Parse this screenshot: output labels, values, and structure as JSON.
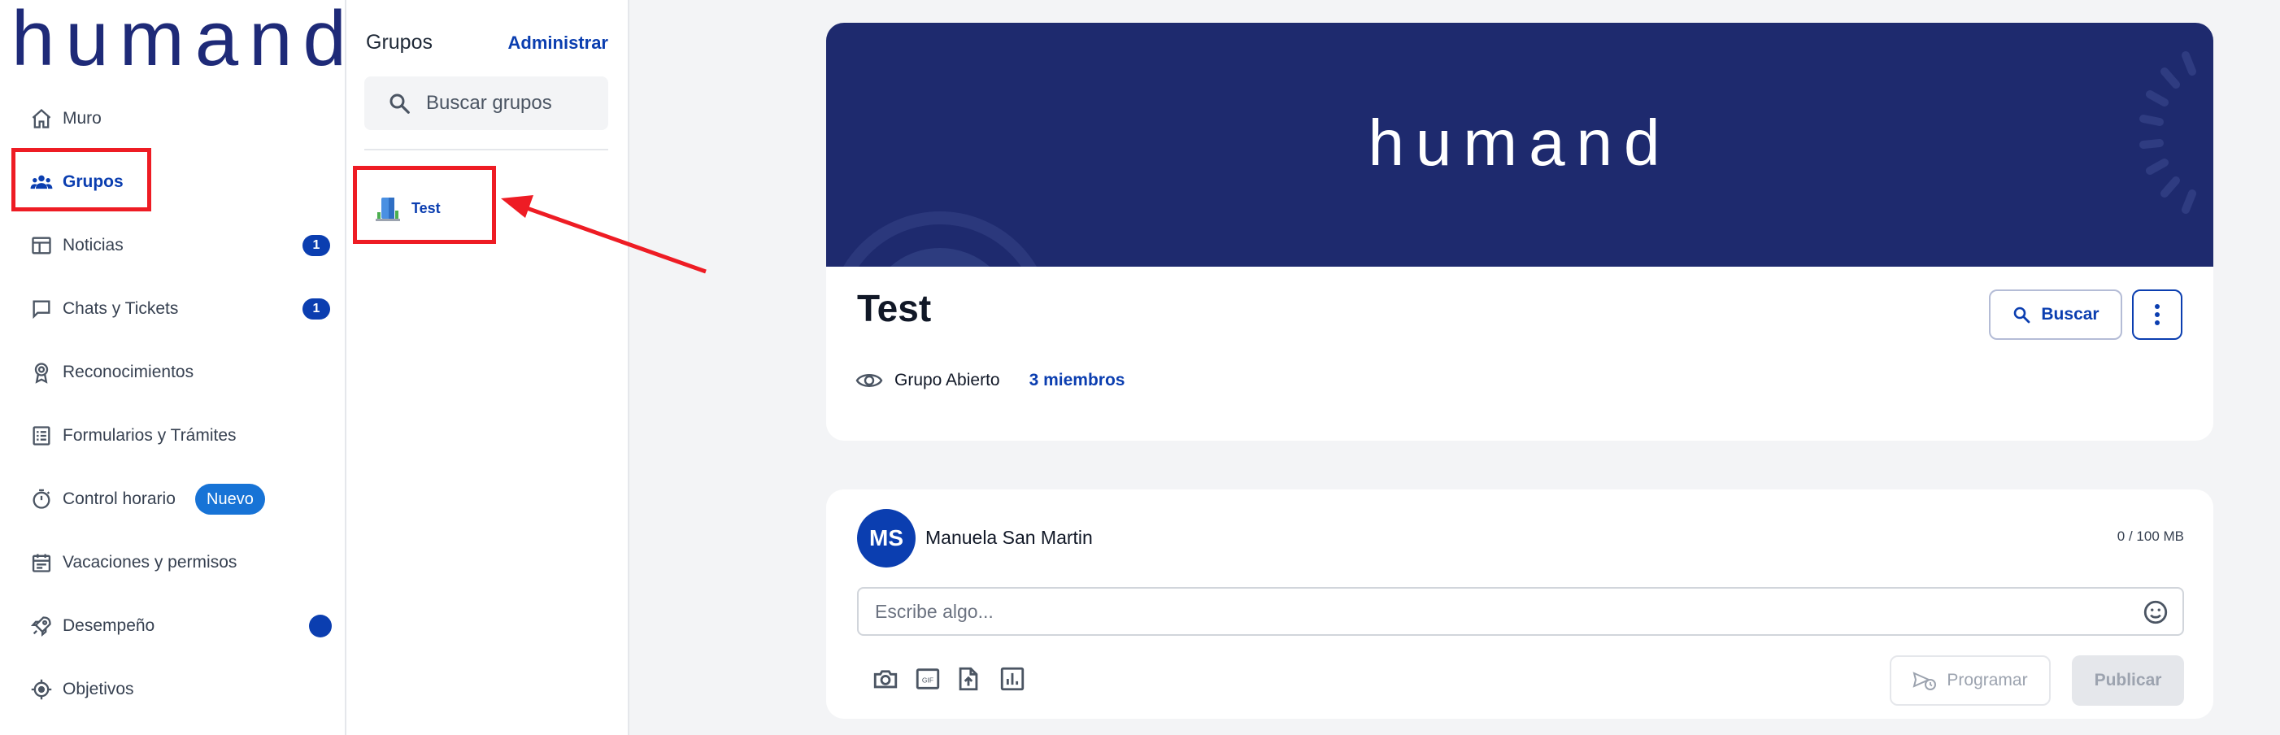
{
  "brand": {
    "logo_text": "humand"
  },
  "colors": {
    "accent": "#0b3eb0",
    "banner": "#1e2a6e",
    "annotation": "#ee1c24",
    "new_badge": "#1773d6"
  },
  "sidebar": {
    "items": [
      {
        "label": "Muro",
        "icon": "home-icon"
      },
      {
        "label": "Grupos",
        "icon": "groups-icon",
        "active": true
      },
      {
        "label": "Noticias",
        "icon": "newspaper-icon",
        "badge": "1"
      },
      {
        "label": "Chats y Tickets",
        "icon": "chat-bubble-icon",
        "badge": "1"
      },
      {
        "label": "Reconocimientos",
        "icon": "award-icon"
      },
      {
        "label": "Formularios y Trámites",
        "icon": "form-list-icon"
      },
      {
        "label": "Control horario",
        "icon": "stopwatch-icon",
        "tag": "Nuevo"
      },
      {
        "label": "Vacaciones y permisos",
        "icon": "calendar-icon"
      },
      {
        "label": "Desempeño",
        "icon": "rocket-icon",
        "dot": true
      },
      {
        "label": "Objetivos",
        "icon": "target-icon"
      }
    ]
  },
  "groups_panel": {
    "title": "Grupos",
    "admin_label": "Administrar",
    "search_placeholder": "Buscar grupos",
    "groups": [
      {
        "name": "Test",
        "icon": "building-icon"
      }
    ]
  },
  "group": {
    "banner_logo": "humand",
    "name": "Test",
    "search_label": "Buscar",
    "visibility": "Grupo Abierto",
    "members": "3 miembros"
  },
  "composer": {
    "avatar_initials": "MS",
    "author": "Manuela San Martin",
    "storage": "0 / 100 MB",
    "placeholder": "Escribe algo...",
    "tools": [
      "camera-icon",
      "gif-icon",
      "file-upload-icon",
      "poll-chart-icon"
    ],
    "schedule_label": "Programar",
    "publish_label": "Publicar"
  }
}
